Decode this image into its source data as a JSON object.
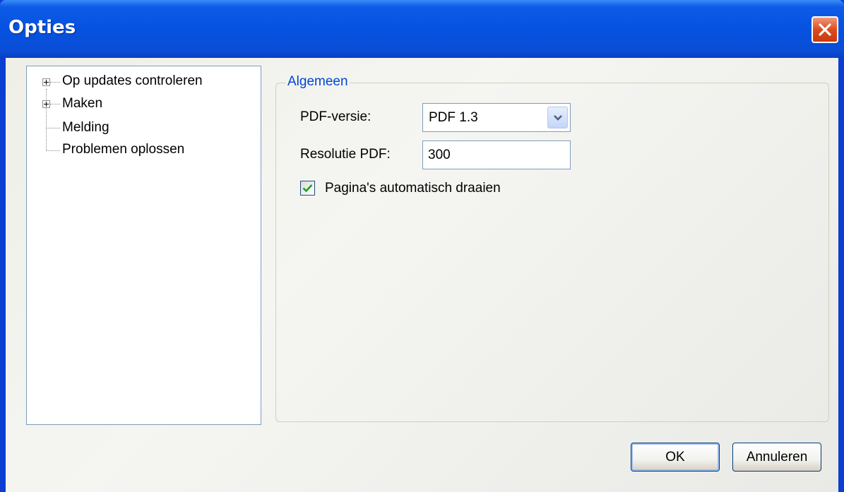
{
  "window": {
    "title": "Opties"
  },
  "tree": {
    "items": [
      {
        "label": "Op updates controleren",
        "expandable": true
      },
      {
        "label": "Maken",
        "expandable": true
      },
      {
        "label": "Melding",
        "expandable": false
      },
      {
        "label": "Problemen oplossen",
        "expandable": false
      }
    ]
  },
  "general": {
    "group_title": "Algemeen",
    "pdf_version_label": "PDF-versie:",
    "pdf_version_value": "PDF 1.3",
    "resolution_label": "Resolutie PDF:",
    "resolution_value": "300",
    "auto_rotate_label": "Pagina's automatisch draaien",
    "auto_rotate_checked": true
  },
  "buttons": {
    "ok": "OK",
    "cancel": "Annuleren"
  },
  "colors": {
    "titlebar": "#0552e0",
    "close": "#dd4a1c",
    "group_title": "#0046d5"
  }
}
